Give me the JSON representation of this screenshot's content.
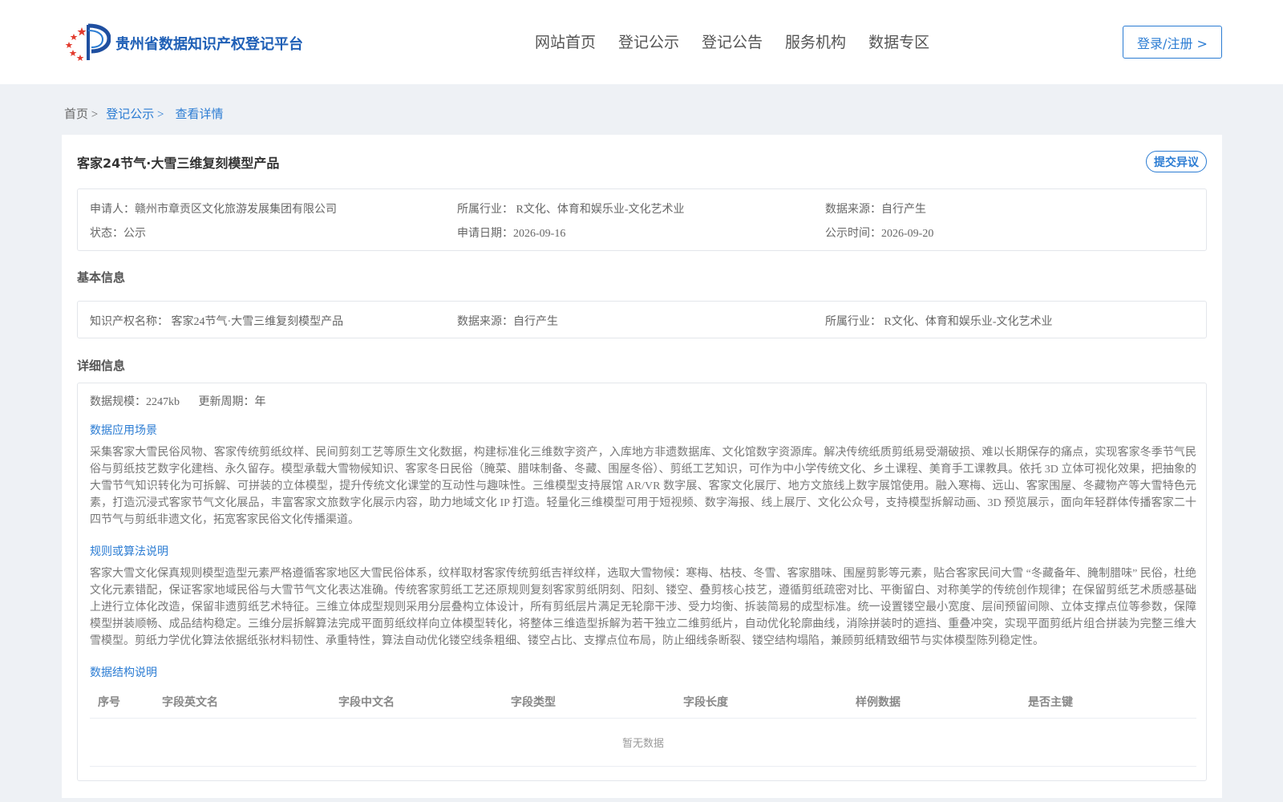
{
  "header": {
    "site_title": "贵州省数据知识产权登记平台",
    "nav": [
      "网站首页",
      "登记公示",
      "登记公告",
      "服务机构",
      "数据专区"
    ],
    "login_label": "登录/注册 >"
  },
  "breadcrumb": {
    "home": "首页 >",
    "section": "登记公示 >",
    "current": "查看详情"
  },
  "detail": {
    "title": "客家24节气·大雪三维复刻模型产品",
    "objection_label": "提交异议",
    "summary": {
      "applicant": "申请人：赣州市章贡区文化旅游发展集团有限公司",
      "industry": "所属行业： R文化、体育和娱乐业-文化艺术业",
      "source": "数据来源：自行产生",
      "status": "状态：公示",
      "apply_date": "申请日期：2026-09-16",
      "publish_date": "公示时间：2026-09-20"
    },
    "basic_head": "基本信息",
    "basic": {
      "ip_name": "知识产权名称： 客家24节气·大雪三维复刻模型产品",
      "source": "数据来源：自行产生",
      "industry": "所属行业： R文化、体育和娱乐业-文化艺术业"
    },
    "detail_head": "详细信息",
    "meta": {
      "scale": "数据规模：2247kb",
      "cycle": "更新周期：年"
    },
    "scene_head": "数据应用场景",
    "scene_text": "采集客家大雪民俗风物、客家传统剪纸纹样、民间剪刻工艺等原生文化数据，构建标准化三维数字资产，入库地方非遗数据库、文化馆数字资源库。解决传统纸质剪纸易受潮破损、难以长期保存的痛点，实现客家冬季节气民俗与剪纸技艺数字化建档、永久留存。模型承载大雪物候知识、客家冬日民俗（腌菜、腊味制备、冬藏、围屋冬俗）、剪纸工艺知识，可作为中小学传统文化、乡土课程、美育手工课教具。依托 3D 立体可视化效果，把抽象的大雪节气知识转化为可拆解、可拼装的立体模型，提升传统文化课堂的互动性与趣味性。三维模型支持展馆 AR/VR 数字展、客家文化展厅、地方文旅线上数字展馆使用。融入寒梅、远山、客家围屋、冬藏物产等大雪特色元素，打造沉浸式客家节气文化展品，丰富客家文旅数字化展示内容，助力地域文化 IP 打造。轻量化三维模型可用于短视频、数字海报、线上展厅、文化公众号，支持模型拆解动画、3D 预览展示，面向年轻群体传播客家二十四节气与剪纸非遗文化，拓宽客家民俗文化传播渠道。",
    "rule_head": "规则或算法说明",
    "rule_text": "客家大雪文化保真规则模型造型元素严格遵循客家地区大雪民俗体系，纹样取材客家传统剪纸吉祥纹样，选取大雪物候：寒梅、枯枝、冬雪、客家腊味、围屋剪影等元素，贴合客家民间大雪 “冬藏备年、腌制腊味” 民俗，杜绝文化元素错配，保证客家地域民俗与大雪节气文化表达准确。传统客家剪纸工艺还原规则复刻客家剪纸阴刻、阳刻、镂空、叠剪核心技艺，遵循剪纸疏密对比、平衡留白、对称美学的传统创作规律；在保留剪纸艺术质感基础上进行立体化改造，保留非遗剪纸艺术特征。三维立体成型规则采用分层叠构立体设计，所有剪纸层片满足无轮廓干涉、受力均衡、拆装简易的成型标准。统一设置镂空最小宽度、层间预留间隙、立体支撑点位等参数，保障模型拼装顺畅、成品结构稳定。三维分层拆解算法完成平面剪纸纹样向立体模型转化，将整体三维造型拆解为若干独立二维剪纸片，自动优化轮廓曲线，消除拼装时的遮挡、重叠冲突，实现平面剪纸片组合拼装为完整三维大雪模型。剪纸力学优化算法依据纸张材料韧性、承重特性，算法自动优化镂空线条粗细、镂空占比、支撑点位布局，防止细线条断裂、镂空结构塌陷，兼顾剪纸精致细节与实体模型陈列稳定性。",
    "struct_head": "数据结构说明",
    "table": {
      "columns": [
        "序号",
        "字段英文名",
        "字段中文名",
        "字段类型",
        "字段长度",
        "样例数据",
        "是否主键"
      ],
      "empty_text": "暂无数据"
    }
  }
}
